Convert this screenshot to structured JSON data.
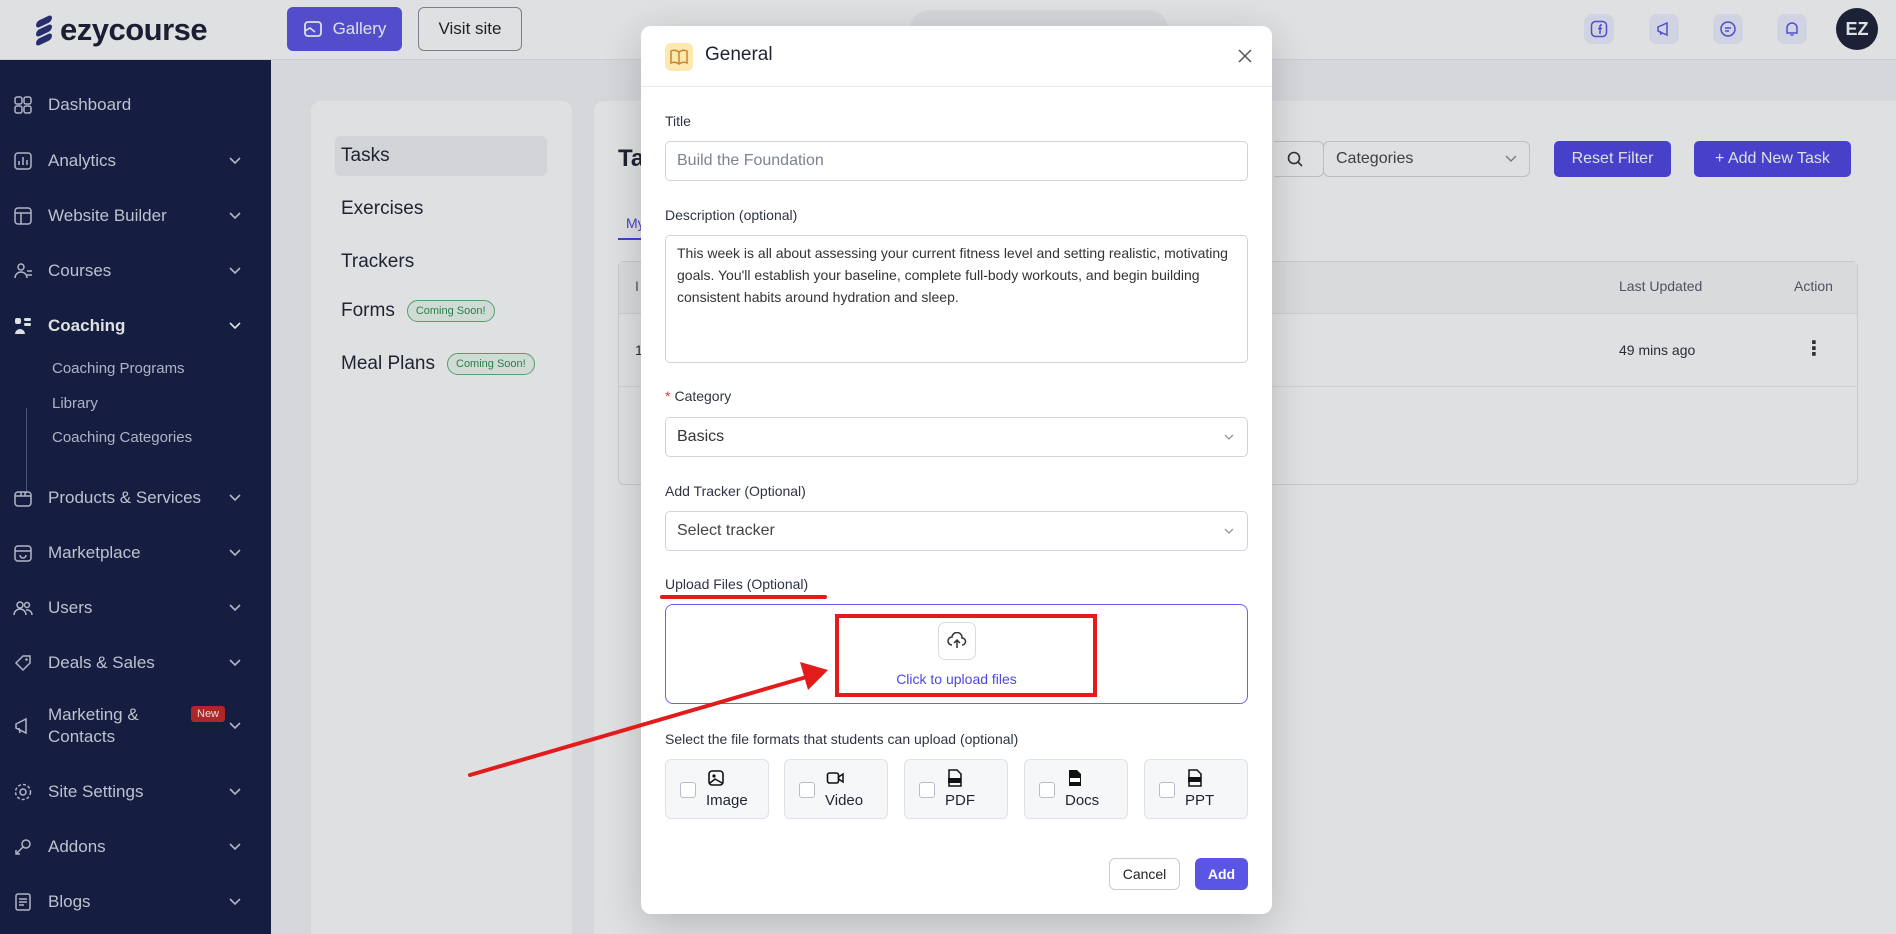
{
  "app": {
    "logo_text": "ezycourse",
    "gallery_label": "Gallery",
    "visit_site_label": "Visit site",
    "avatar_text": "EZ"
  },
  "sidebar": {
    "items": [
      {
        "label": "Dashboard"
      },
      {
        "label": "Analytics"
      },
      {
        "label": "Website Builder"
      },
      {
        "label": "Courses"
      },
      {
        "label": "Coaching"
      },
      {
        "label": "Products & Services"
      },
      {
        "label": "Marketplace"
      },
      {
        "label": "Users"
      },
      {
        "label": "Deals & Sales"
      },
      {
        "label": "Marketing &"
      },
      {
        "label": "Site Settings"
      },
      {
        "label": "Addons"
      },
      {
        "label": "Blogs"
      }
    ],
    "marketing_line2": "Contacts",
    "new_badge": "New",
    "coaching_sub": [
      "Coaching Programs",
      "Library",
      "Coaching Categories"
    ]
  },
  "left_panel": {
    "tabs": [
      "Tasks",
      "Exercises",
      "Trackers",
      "Forms",
      "Meal Plans"
    ],
    "coming_soon": "Coming Soon!"
  },
  "main": {
    "heading": "Ta",
    "sub_tab": "My",
    "categories_filter": "Categories",
    "reset_filter": "Reset Filter",
    "add_new_task": "+ Add New Task",
    "columns": [
      "I",
      "Last Updated",
      "Action"
    ],
    "row": {
      "index": "1",
      "last_updated": "49 mins ago"
    }
  },
  "modal": {
    "title": "General",
    "title_label": "Title",
    "title_placeholder": "Build the Foundation",
    "description_label": "Description (optional)",
    "description_value": "This week is all about assessing your current fitness level and setting realistic, motivating goals. You'll establish your baseline, complete full-body workouts, and begin building consistent habits around hydration and sleep.",
    "category_label": "Category",
    "category_value": "Basics",
    "tracker_label": "Add Tracker (Optional)",
    "tracker_placeholder": "Select tracker",
    "upload_label": "Upload Files (Optional)",
    "upload_text": "Click to upload files",
    "formats_label": "Select the file formats that students can upload (optional)",
    "formats": [
      "Image",
      "Video",
      "PDF",
      "Docs",
      "PPT"
    ],
    "cancel_label": "Cancel",
    "add_label": "Add"
  },
  "colors": {
    "accent": "#5b55e6",
    "sidebar_bg": "#141d44",
    "annotation_red": "#e31b1b"
  }
}
